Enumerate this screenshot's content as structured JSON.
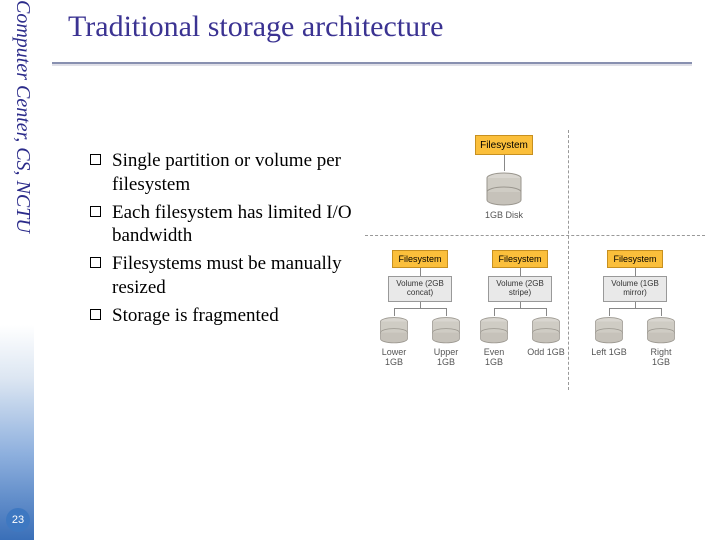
{
  "sidebar": {
    "text": "Computer Center, CS, NCTU"
  },
  "page_number": "23",
  "title": "Traditional storage architecture",
  "bullets": [
    "Single partition or volume per filesystem",
    "Each filesystem has limited I/O bandwidth",
    "Filesystems must be manually resized",
    "Storage is fragmented"
  ],
  "diagram": {
    "top": {
      "fs_label": "Filesystem",
      "disk_label": "1GB Disk"
    },
    "groups": [
      {
        "fs": "Filesystem",
        "vol": "Volume (2GB concat)",
        "disks": [
          "Lower 1GB",
          "Upper 1GB"
        ]
      },
      {
        "fs": "Filesystem",
        "vol": "Volume (2GB stripe)",
        "disks": [
          "Even 1GB",
          "Odd 1GB"
        ]
      },
      {
        "fs": "Filesystem",
        "vol": "Volume (1GB mirror)",
        "disks": [
          "Left 1GB",
          "Right 1GB"
        ]
      }
    ]
  }
}
